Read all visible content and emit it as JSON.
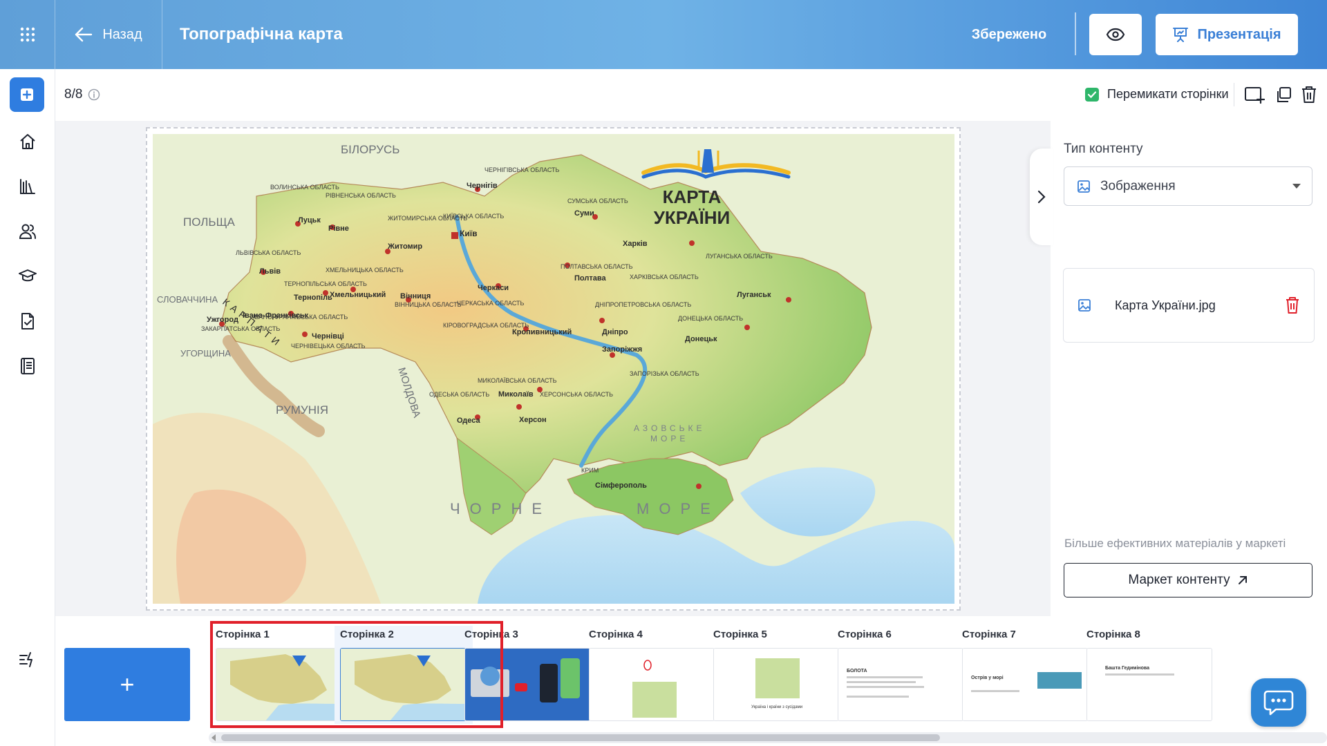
{
  "header": {
    "back_label": "Назад",
    "title": "Топографічна карта",
    "saved_label": "Збережено",
    "present_label": "Презентація",
    "bg_gradient": [
      "#5f9fd8",
      "#6fb2e6",
      "#3f86d6"
    ]
  },
  "sidebar": {
    "items": [
      {
        "icon": "plus-square-icon"
      },
      {
        "icon": "home-icon"
      },
      {
        "icon": "library-icon"
      },
      {
        "icon": "users-icon"
      },
      {
        "icon": "graduation-cap-icon"
      },
      {
        "icon": "checked-document-icon"
      },
      {
        "icon": "notebook-icon"
      },
      {
        "icon": "lightning-list-icon"
      }
    ]
  },
  "toolbar": {
    "page_counter": "8/8",
    "switch_pages_label": "Перемикати сторінки",
    "switch_pages_checked": true
  },
  "slide": {
    "map": {
      "title_line1": "КАРТА",
      "title_line2": "УКРАЇНИ",
      "neighbors": [
        "БІЛОРУСЬ",
        "ПОЛЬЩА",
        "СЛОВАЧЧИНА",
        "УГОРЩИНА",
        "РУМУНІЯ",
        "МОЛДОВА"
      ],
      "seas": [
        "ЧОРНЕ",
        "МОРЕ",
        "АЗОВСЬКЕ",
        "МОРЕ"
      ],
      "mountains": "КАРПАТИ",
      "cities": [
        "Київ",
        "Харків",
        "Дніпро",
        "Одеса",
        "Львів",
        "Запоріжжя",
        "Херсон",
        "Луганськ",
        "Донецьк",
        "Полтава",
        "Суми",
        "Чернігів",
        "Житомир",
        "Вінниця",
        "Черкаси",
        "Миколаїв",
        "Сімферополь",
        "Ужгород",
        "Чернівці",
        "Тернопіль",
        "Хмельницький",
        "Рівне",
        "Луцьк",
        "Кропивницький",
        "Івано-Франківськ"
      ],
      "oblasts": [
        "ВОЛИНСЬКА ОБЛАСТЬ",
        "РІВНЕНСЬКА ОБЛАСТЬ",
        "ЖИТОМИРСЬКА ОБЛАСТЬ",
        "КИЇВСЬКА ОБЛАСТЬ",
        "ЧЕРНІГІВСЬКА ОБЛАСТЬ",
        "СУМСЬКА ОБЛАСТЬ",
        "ХАРКІВСЬКА ОБЛАСТЬ",
        "ЛУГАНСЬКА ОБЛАСТЬ",
        "ДОНЕЦЬКА ОБЛАСТЬ",
        "ЗАПОРІЗЬКА ОБЛАСТЬ",
        "ДНІПРОПЕТРОВСЬКА ОБЛАСТЬ",
        "ПОЛТАВСЬКА ОБЛАСТЬ",
        "ЧЕРКАСЬКА ОБЛАСТЬ",
        "ВІННИЦЬКА ОБЛАСТЬ",
        "ХМЕЛЬНИЦЬКА ОБЛАСТЬ",
        "ТЕРНОПІЛЬСЬКА ОБЛАСТЬ",
        "ЛЬВІВСЬКА ОБЛАСТЬ",
        "ІВАНО-ФРАНКІВСЬКА ОБЛАСТЬ",
        "ЗАКАРПАТСЬКА ОБЛАСТЬ",
        "ЧЕРНІВЕЦЬКА ОБЛАСТЬ",
        "КІРОВОГРАДСЬКА ОБЛАСТЬ",
        "МИКОЛАЇВСЬКА ОБЛАСТЬ",
        "ОДЕСЬКА ОБЛАСТЬ",
        "ХЕРСОНСЬКА ОБЛАСТЬ",
        "КРИМ"
      ]
    }
  },
  "right_panel": {
    "content_type_label": "Тип контенту",
    "content_type_value": "Зображення",
    "file_name": "Карта України.jpg",
    "market_note": "Більше ефективних матеріалів у маркеті",
    "market_button": "Маркет контенту"
  },
  "pages": {
    "add_label": "+",
    "items": [
      {
        "label": "Сторінка 1",
        "thumb": "map"
      },
      {
        "label": "Сторінка 2",
        "thumb": "map"
      },
      {
        "label": "Сторінка 3",
        "thumb": "video"
      },
      {
        "label": "Сторінка 4",
        "thumb": "small-map"
      },
      {
        "label": "Сторінка 5",
        "thumb": "map-caption",
        "caption": "Україна і країни з сусідами"
      },
      {
        "label": "Сторінка 6",
        "thumb": "text",
        "heading": "БОЛОТА"
      },
      {
        "label": "Сторінка 7",
        "thumb": "text-image",
        "heading": "Острів у морі"
      },
      {
        "label": "Сторінка 8",
        "thumb": "text",
        "heading": "Башта Гедимінова"
      }
    ]
  },
  "colors": {
    "accent": "#2f7de0",
    "selection": "#e0202a",
    "check": "#2eb66a",
    "delete": "#e0202a"
  }
}
